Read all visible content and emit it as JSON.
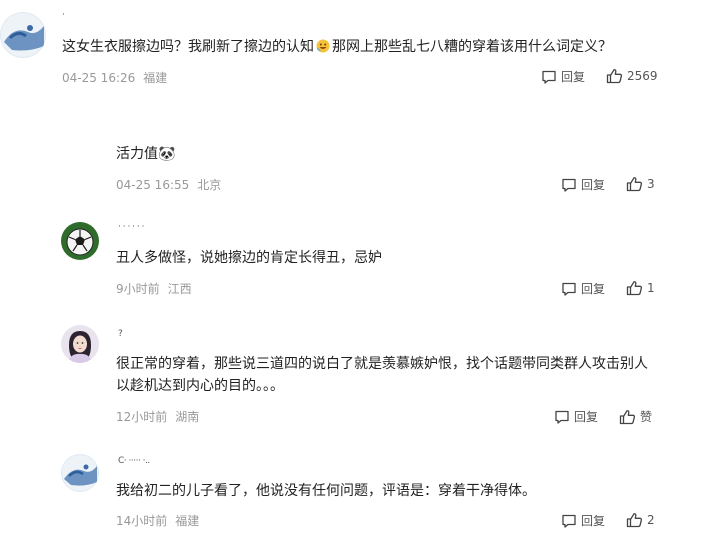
{
  "comments": [
    {
      "name": "·",
      "text_a": "这女生衣服擦边吗？我刷新了擦边的认知",
      "text_b": "那网上那些乱七八糟的穿着该用什么词定义？",
      "time": "04-25 16:26",
      "location": "福建",
      "reply_label": "回复",
      "like_count": "2569",
      "avatar_icon": "bird-painting-avatar"
    },
    {
      "text": "活力值🐼",
      "time": "04-25 16:55",
      "location": "北京",
      "reply_label": "回复",
      "like_count": "3"
    },
    {
      "name": "· · · · · ·",
      "text": "丑人多做怪，说她擦边的肯定长得丑，忌妒",
      "time": "9小时前",
      "location": "江西",
      "reply_label": "回复",
      "like_count": "1",
      "avatar_icon": "soccer-ball-avatar"
    },
    {
      "name": "?",
      "text_line1": "很正常的穿着，那些说三道四的说白了就是羡慕嫉妒恨，找个话题带同类群人攻击别人",
      "text_line2": "以趁机达到内心的目的。。。",
      "time": "12小时前",
      "location": "湖南",
      "reply_label": "回复",
      "like_label": "赞",
      "avatar_icon": "woman-portrait-avatar"
    },
    {
      "name": "C· ·····  ·..",
      "text": "我给初二的儿子看了，他说没有任何问题，评语是：穿着干净得体。",
      "time": "14小时前",
      "location": "福建",
      "reply_label": "回复",
      "like_count": "2",
      "avatar_icon": "bird-painting-avatar"
    }
  ],
  "colors": {
    "text": "#222222",
    "meta": "#999999",
    "action": "#555555",
    "icon": "#444444"
  }
}
